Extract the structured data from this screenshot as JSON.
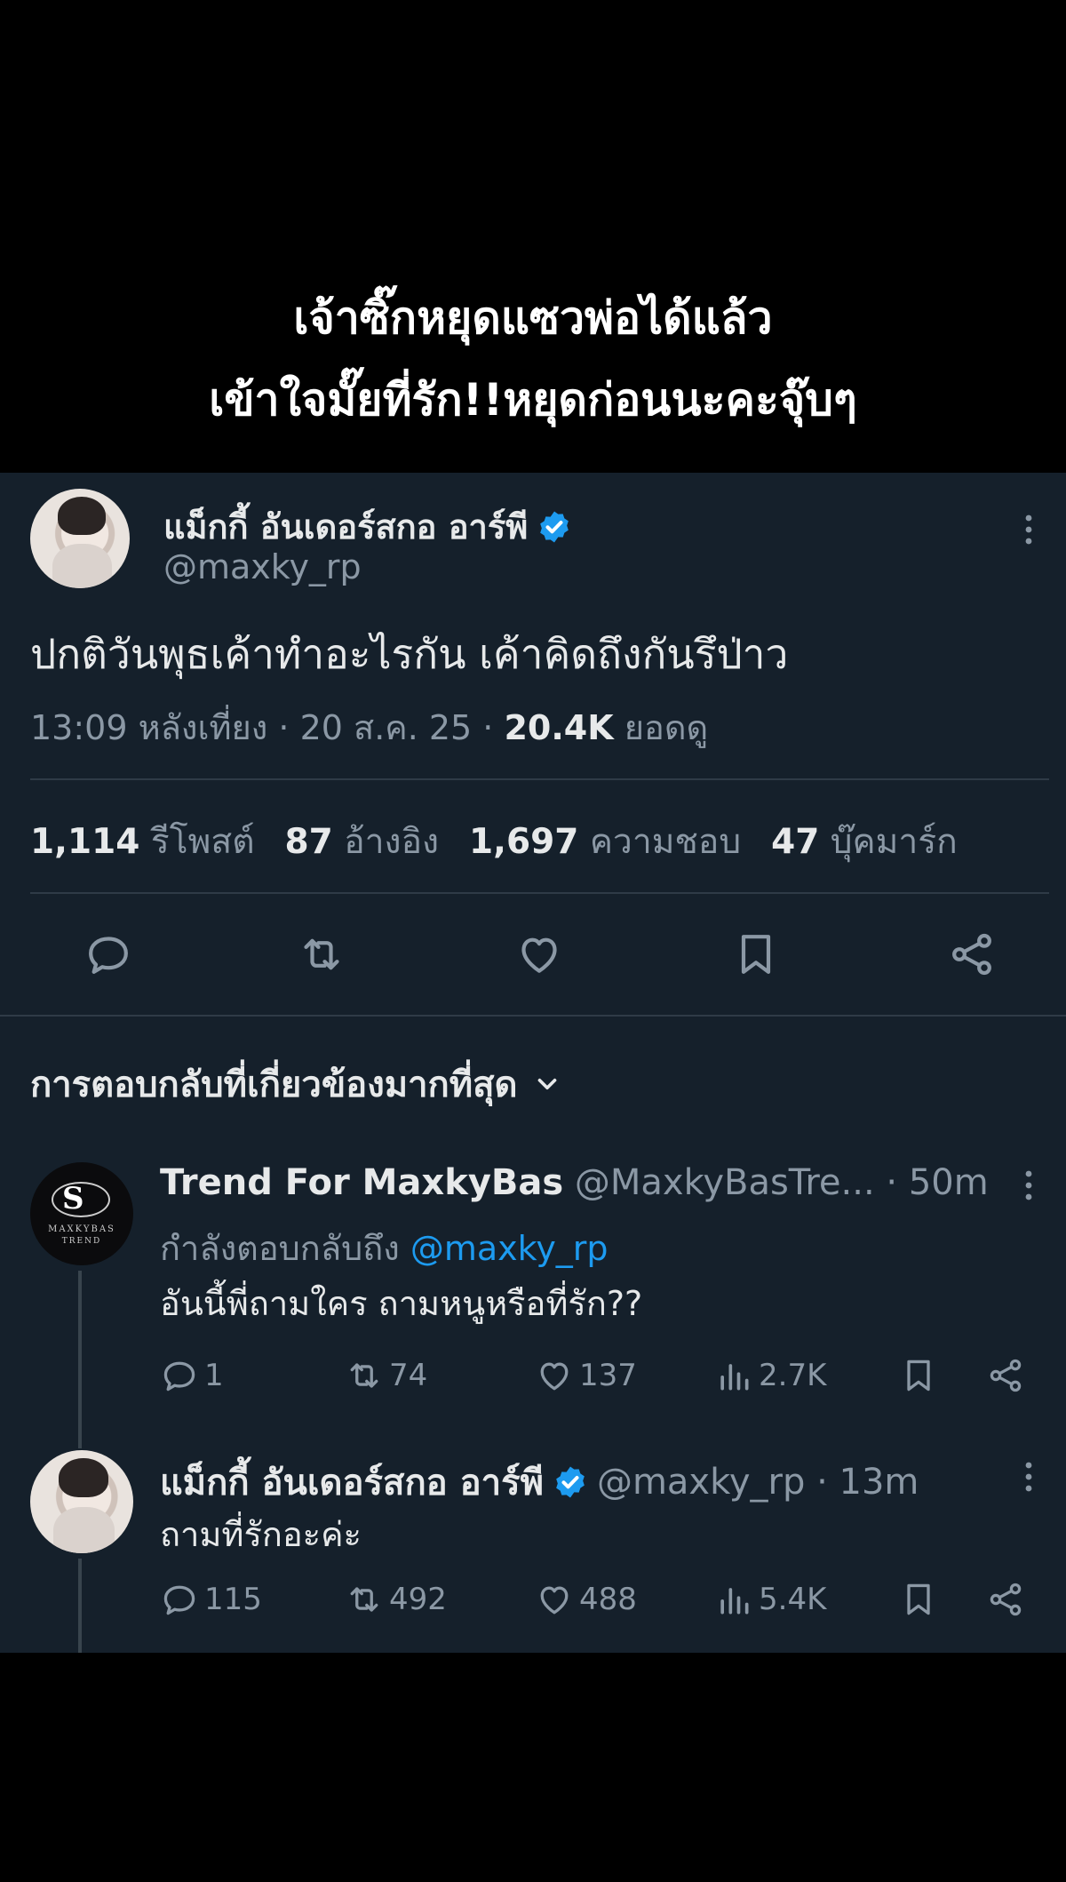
{
  "caption": {
    "line1": "เจ้าซิ๊กหยุดแซวพ่อได้แล้ว",
    "line2": "เข้าใจมั๊ยที่รัก!!หยุดก่อนนะคะจุ๊บๆ"
  },
  "tweet": {
    "display_name": "แม็กกี้ อันเดอร์สกอ อาร์พี",
    "handle": "@maxky_rp",
    "text": "ปกติวันพุธเค้าทำอะไรกัน เค้าคิดถึงกันรึป่าว",
    "meta_time": "13:09 หลังเที่ยง · 20 ส.ค. 25 · ",
    "views_count": "20.4K",
    "views_label": " ยอดดู",
    "stats": {
      "reposts_num": "1,114",
      "reposts_label": "รีโพสต์",
      "quotes_num": "87",
      "quotes_label": "อ้างอิง",
      "likes_num": "1,697",
      "likes_label": "ความชอบ",
      "bookmarks_num": "47",
      "bookmarks_label": "บุ๊คมาร์ก"
    }
  },
  "replies_header": "การตอบกลับที่เกี่ยวข้องมากที่สุด",
  "replies": [
    {
      "display_name": "Trend For MaxkyBas",
      "handle": "@MaxkyBasTre...",
      "time": " · 50m",
      "replying_prefix": "กำลังตอบกลับถึง ",
      "replying_to": "@maxky_rp",
      "text": "อันนี้พี่ถามใคร ถามหนูหรือที่รัก??",
      "avatar_text_top": "MAXKYBAS",
      "avatar_text_bottom": "TREND",
      "counts": {
        "replies": "1",
        "reposts": "74",
        "likes": "137",
        "views": "2.7K"
      }
    },
    {
      "display_name": "แม็กกี้ อันเดอร์สกอ อาร์พี",
      "handle": "@maxky_rp",
      "time": " · 13m",
      "text": "ถามที่รักอะค่ะ",
      "counts": {
        "replies": "115",
        "reposts": "492",
        "likes": "488",
        "views": "5.4K"
      }
    }
  ],
  "colors": {
    "background": "#15202b",
    "text": "#e7e9ea",
    "muted": "#8b98a5",
    "accent": "#1d9bf0",
    "divider": "#2f3b47"
  },
  "icons": [
    "verified-badge-icon",
    "more-icon",
    "reply-icon",
    "repost-icon",
    "like-icon",
    "bookmark-icon",
    "share-icon",
    "views-icon",
    "chevron-down-icon"
  ]
}
